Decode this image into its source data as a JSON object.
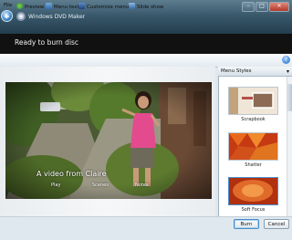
{
  "window": {
    "title": "Windows DVD Maker",
    "controls": [
      "–",
      "□",
      "✕"
    ]
  },
  "header": {
    "title": "Ready to burn disc"
  },
  "toolbar": {
    "file": "File",
    "preview": "Preview",
    "menu_text": "Menu text",
    "customize_menu": "Customize menu",
    "slide_show": "Slide show"
  },
  "preview": {
    "menu_title": "A video from Claire",
    "buttons": [
      "Play",
      "Scenes",
      "Notes"
    ]
  },
  "styles_panel": {
    "header": "Menu Styles",
    "items": [
      "Scrapbook",
      "Shatter",
      "Soft Focus"
    ]
  },
  "footer": {
    "burn_label": "Burn",
    "cancel_label": "Cancel"
  },
  "colors": {
    "title_bar": "#3a596c",
    "header_band": "#111111",
    "accent": "#3c87c8"
  }
}
